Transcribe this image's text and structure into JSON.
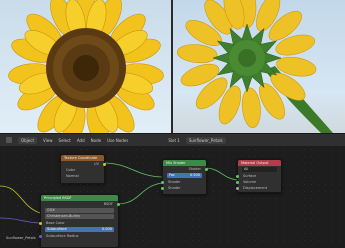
{
  "header": {
    "mode": "Object",
    "menus": [
      "View",
      "Select",
      "Add",
      "Node"
    ],
    "use_nodes_label": "Use Nodes",
    "slot": "Slot 1",
    "material": "Sunflower_Petals"
  },
  "nodes": {
    "texcoord": {
      "title": "Texture Coordinate",
      "out_label": "UV",
      "rows": [
        "Color",
        "Normal"
      ]
    },
    "imgtex": {
      "title": "Image Texture",
      "rows": [
        "Color",
        "Alpha"
      ],
      "fields": [
        "sRGB",
        "Linear",
        "Flat",
        "Repeat"
      ],
      "vector": "Vector"
    },
    "principled": {
      "title": "Principled BSDF",
      "out_label": "BSDF",
      "fields": [
        "GGX",
        "Christensen-Burley"
      ],
      "rows": [
        "Base Color",
        "Subsurface",
        "Subsurface Radius",
        "Subsurface Color"
      ],
      "subsurface_value": "0.000"
    },
    "mix": {
      "title": "Mix Shader",
      "out_label": "Shader",
      "fac_label": "Fac",
      "fac_value": "0.500",
      "rows": [
        "Shader",
        "Shader"
      ]
    },
    "output": {
      "title": "Material Output",
      "target": "All",
      "rows": [
        "Surface",
        "Volume",
        "Displacement"
      ]
    }
  },
  "floating_label": "Sunflower_Petals"
}
